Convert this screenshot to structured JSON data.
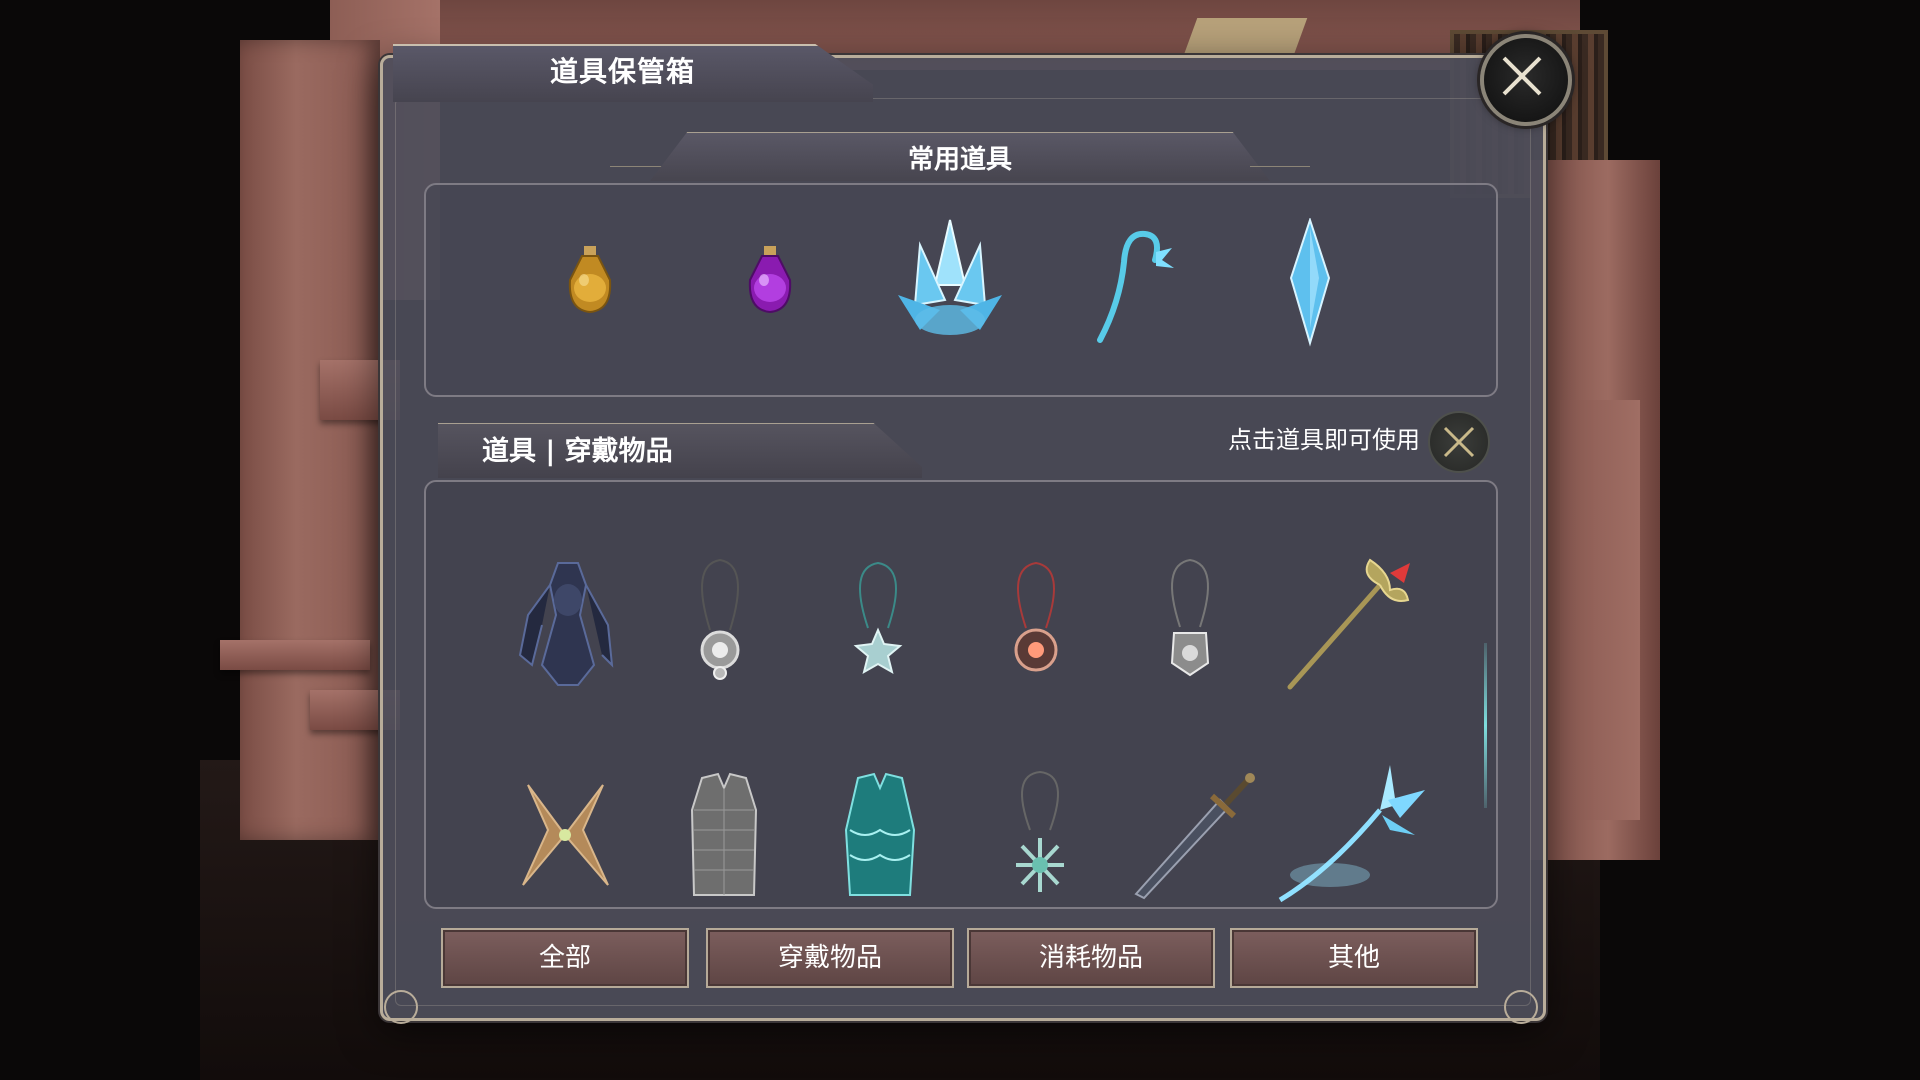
{
  "window": {
    "title": "道具保管箱",
    "close_icon": "close-x-icon"
  },
  "frequent": {
    "header": "常用道具",
    "items": [
      {
        "name": "amber-potion-icon",
        "color": "#d8a636"
      },
      {
        "name": "purple-potion-icon",
        "color": "#a63cd8"
      },
      {
        "name": "ice-crystal-cluster-icon",
        "color": "#7fd0f0"
      },
      {
        "name": "ice-hook-staff-icon",
        "color": "#5ecfe8"
      },
      {
        "name": "ice-shard-icon",
        "color": "#6ec8f0"
      }
    ]
  },
  "inventory": {
    "tab_label": "道具 | 穿戴物品",
    "hint": "点击道具即可使用",
    "hint_icon": "crossed-swords-icon",
    "items": [
      {
        "name": "dark-armor-icon"
      },
      {
        "name": "silver-amulet-icon"
      },
      {
        "name": "star-amulet-icon"
      },
      {
        "name": "sun-amulet-icon"
      },
      {
        "name": "shield-amulet-icon"
      },
      {
        "name": "golden-staff-icon"
      },
      {
        "name": "leaf-wings-icon"
      },
      {
        "name": "chainmail-vest-icon"
      },
      {
        "name": "teal-scale-vest-icon"
      },
      {
        "name": "snowflake-amulet-icon"
      },
      {
        "name": "steel-sword-icon"
      },
      {
        "name": "ice-wing-staff-icon"
      }
    ]
  },
  "tabs": {
    "all": "全部",
    "wearable": "穿戴物品",
    "consumable": "消耗物品",
    "other": "其他"
  }
}
